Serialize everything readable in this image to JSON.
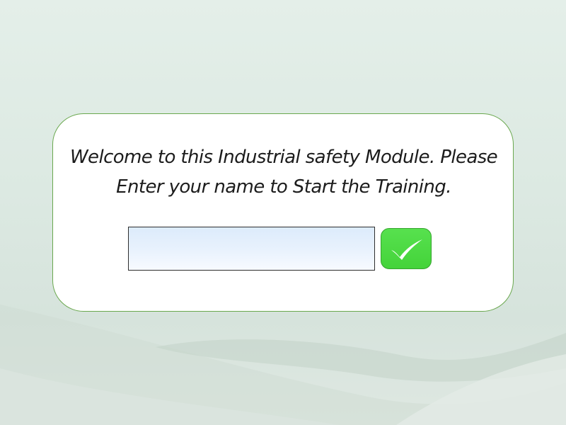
{
  "dialog": {
    "message_line1": "Welcome to this Industrial safety Module. Please",
    "message_line2": "Enter your name to Start the Training.",
    "name_input": {
      "value": "",
      "placeholder": ""
    },
    "submit_button": {
      "icon": "checkmark-icon"
    }
  },
  "colors": {
    "dialog_border": "#6aa84f",
    "button_fill": "#44d33a",
    "input_fill": "#e4effc"
  }
}
